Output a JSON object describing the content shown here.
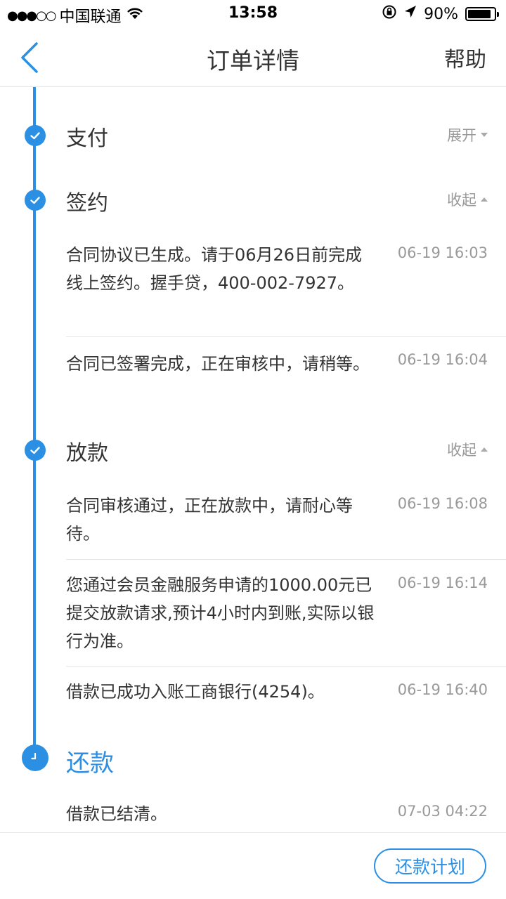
{
  "status_bar": {
    "signal_dots": "●●●○○",
    "carrier": "中国联通",
    "time": "13:58",
    "battery_text": "90%",
    "battery_level": 0.9
  },
  "nav": {
    "title": "订单详情",
    "help_label": "帮助",
    "accent_color": "#2b8fe4"
  },
  "timeline": {
    "pay": {
      "title": "支付",
      "toggle_label": "展开"
    },
    "sign": {
      "title": "签约",
      "toggle_label": "收起",
      "entries": [
        {
          "text": "合同协议已生成。请于06月26日前完成线上签约。握手贷，400-002-7927。",
          "time": "06-19 16:03"
        },
        {
          "text": "合同已签署完成，正在审核中，请稍等。",
          "time": "06-19 16:04"
        }
      ]
    },
    "loan": {
      "title": "放款",
      "toggle_label": "收起",
      "entries": [
        {
          "text": "合同审核通过，正在放款中，请耐心等待。",
          "time": "06-19 16:08"
        },
        {
          "text": "您通过会员金融服务申请的1000.00元已提交放款请求,预计4小时内到账,实际以银行为准。",
          "time": "06-19 16:14"
        },
        {
          "text": "借款已成功入账工商银行(4254)。",
          "time": "06-19 16:40"
        }
      ]
    },
    "repay": {
      "title": "还款",
      "entries": [
        {
          "text": "借款已结清。",
          "time": "07-03 04:22"
        }
      ]
    }
  },
  "bottom": {
    "plan_button": "还款计划"
  }
}
